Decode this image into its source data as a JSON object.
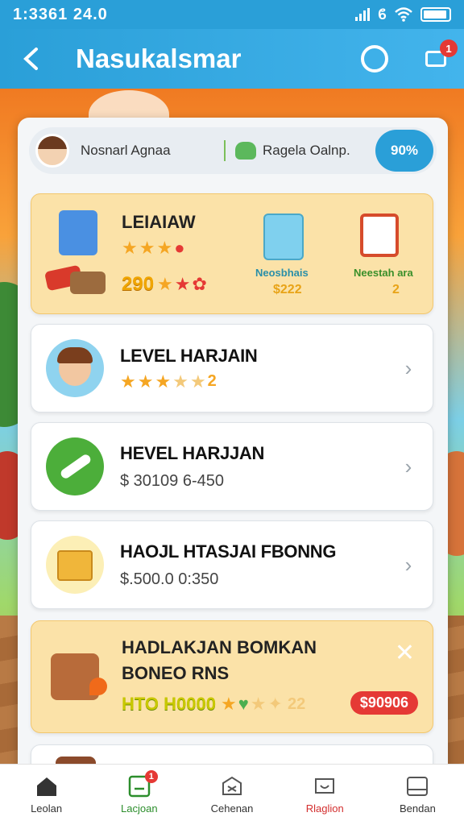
{
  "status": {
    "time": "1:3361 24.0"
  },
  "appbar": {
    "title": "Nasukalsmar",
    "notification_count": "1"
  },
  "info": {
    "name": "Nosnarl Agnaa",
    "region": "Ragela Oalnp.",
    "percent": "90%"
  },
  "featured": {
    "title": "LEIAIAW",
    "score": "290",
    "items": [
      {
        "label": "Neosbhais",
        "price": "$222"
      },
      {
        "label": "Neestah ara",
        "price": "2"
      }
    ]
  },
  "list": [
    {
      "title": "LEVEL HARJAIN",
      "sub": "2",
      "icon": "boy-avatar-icon"
    },
    {
      "title": "HEVEL HARJJAN",
      "sub": "$ 30109 6-450",
      "icon": "pencil-icon"
    },
    {
      "title": "HAOJL HTASJAI FBONNG",
      "sub": "$.500.0 0:350",
      "icon": "package-icon"
    }
  ],
  "promo": {
    "title_line1": "HADLAKJAN BOMKAN",
    "title_line2": "BONEO RNS",
    "score": "HTO H0000",
    "extra": "22",
    "pill": "$90906"
  },
  "nav": [
    {
      "label": "Leolan",
      "icon": "home-icon"
    },
    {
      "label": "Lacjoan",
      "icon": "list-icon",
      "badge": "1"
    },
    {
      "label": "Cehenan",
      "icon": "box-icon"
    },
    {
      "label": "Rlaglion",
      "icon": "chat-icon"
    },
    {
      "label": "Bendan",
      "icon": "tablet-icon"
    }
  ],
  "colors": {
    "primary": "#2a9fd8",
    "accent_gold": "#fbe2a8",
    "badge": "#e53935"
  }
}
